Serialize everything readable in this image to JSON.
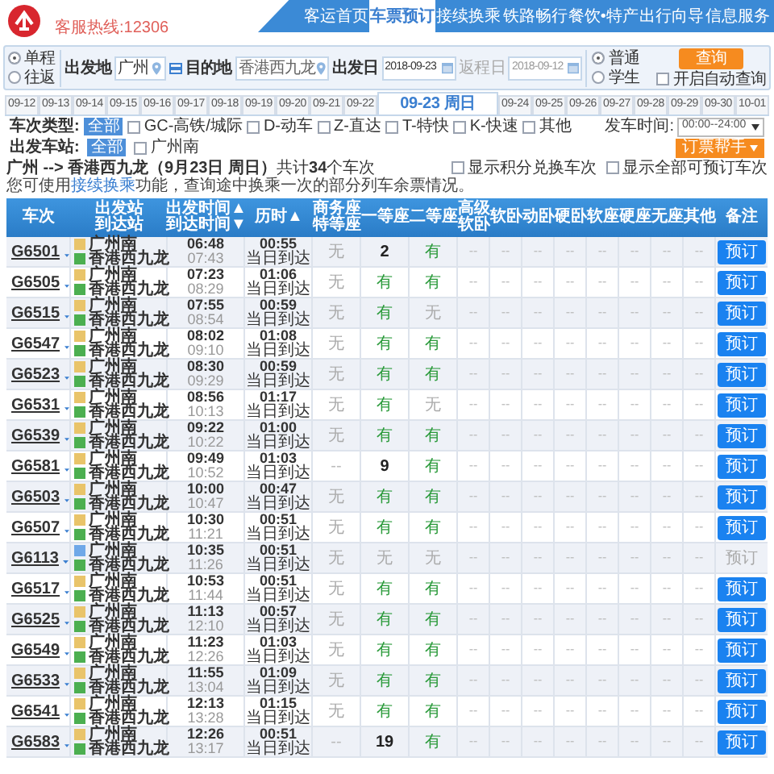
{
  "header": {
    "hotline": "客服热线:12306",
    "nav": [
      {
        "label": "客运首页",
        "selected": false
      },
      {
        "label": "车票预订",
        "selected": true
      },
      {
        "label": "接续换乘",
        "selected": false
      },
      {
        "label": "铁路畅行",
        "selected": false
      },
      {
        "label": "餐饮•特产",
        "selected": false
      },
      {
        "label": "出行向导",
        "selected": false
      },
      {
        "label": "信息服务",
        "selected": false
      }
    ]
  },
  "search": {
    "trip_types": [
      {
        "label": "单程",
        "selected": true
      },
      {
        "label": "往返",
        "selected": false
      }
    ],
    "from": {
      "label": "出发地",
      "value": "广州"
    },
    "to": {
      "label": "目的地",
      "value": "香港西九龙"
    },
    "depart_date": {
      "label": "出发日",
      "value": "2018-09-23"
    },
    "return_date": {
      "label": "返程日",
      "value": "2018-09-12",
      "disabled": true
    },
    "passenger_types": [
      {
        "label": "普通",
        "selected": true
      },
      {
        "label": "学生",
        "selected": false
      }
    ],
    "query_button": "查询",
    "auto_query": {
      "label": "开启自动查询",
      "checked": false
    }
  },
  "dates": [
    {
      "label": "09-12",
      "selected": false
    },
    {
      "label": "09-13",
      "selected": false
    },
    {
      "label": "09-14",
      "selected": false
    },
    {
      "label": "09-15",
      "selected": false
    },
    {
      "label": "09-16",
      "selected": false
    },
    {
      "label": "09-17",
      "selected": false
    },
    {
      "label": "09-18",
      "selected": false
    },
    {
      "label": "09-19",
      "selected": false
    },
    {
      "label": "09-20",
      "selected": false
    },
    {
      "label": "09-21",
      "selected": false
    },
    {
      "label": "09-22",
      "selected": false
    },
    {
      "label": "09-23 周日",
      "selected": true
    },
    {
      "label": "09-24",
      "selected": false
    },
    {
      "label": "09-25",
      "selected": false
    },
    {
      "label": "09-26",
      "selected": false
    },
    {
      "label": "09-27",
      "selected": false
    },
    {
      "label": "09-28",
      "selected": false
    },
    {
      "label": "09-29",
      "selected": false
    },
    {
      "label": "09-30",
      "selected": false
    },
    {
      "label": "10-01",
      "selected": false
    }
  ],
  "filters": {
    "train_type_label": "车次类型:",
    "train_type_all": "全部",
    "train_types": [
      {
        "label": "GC-高铁/城际",
        "checked": false
      },
      {
        "label": "D-动车",
        "checked": false
      },
      {
        "label": "Z-直达",
        "checked": false
      },
      {
        "label": "T-特快",
        "checked": false
      },
      {
        "label": "K-快速",
        "checked": false
      },
      {
        "label": "其他",
        "checked": false
      }
    ],
    "depart_time_label": "发车时间:",
    "depart_time_value": "00:00--24:00",
    "station_label": "出发车站:",
    "station_all": "全部",
    "stations": [
      {
        "label": "广州南",
        "checked": false
      }
    ],
    "helper_button": "订票帮手"
  },
  "summary": {
    "title": "**广州 --> 香港西九龙（9月23日  周日）**共计**34**个车次",
    "hint_before": "您可使用",
    "hint_link": "接续换乘",
    "hint_after": "功能，查询途中换乘一次的部分列车余票情况。",
    "options": [
      {
        "label": "显示积分兑换车次",
        "checked": false
      },
      {
        "label": "显示全部可预订车次",
        "checked": false
      }
    ]
  },
  "table": {
    "columns": [
      [
        "车次"
      ],
      [
        "出发站",
        "到达站"
      ],
      [
        "出发时间▲",
        "到达时间▼"
      ],
      [
        "历时▲"
      ],
      [
        "商务座",
        "特等座"
      ],
      [
        "一等座"
      ],
      [
        "二等座"
      ],
      [
        "高级",
        "软卧"
      ],
      [
        "软卧"
      ],
      [
        "动卧"
      ],
      [
        "硬卧"
      ],
      [
        "软座"
      ],
      [
        "硬座"
      ],
      [
        "无座"
      ],
      [
        "其他"
      ],
      [
        "备注"
      ]
    ],
    "rows": [
      {
        "train": "G6501",
        "from": "广州南",
        "passing_station": false,
        "to": "香港西九龙",
        "depart": "06:48",
        "arrive": "07:43",
        "duration": "00:55",
        "arrival_day": "当日到达",
        "seats": [
          {
            "text": "无",
            "kind": "no"
          },
          {
            "text": "2",
            "kind": "count"
          },
          {
            "text": "有",
            "kind": "yes"
          }
        ],
        "other_seats": [
          "--",
          "--",
          "--",
          "--",
          "--",
          "--",
          "--",
          "--"
        ],
        "book": "预订",
        "bookable": true
      },
      {
        "train": "G6505",
        "from": "广州南",
        "passing_station": false,
        "to": "香港西九龙",
        "depart": "07:23",
        "arrive": "08:29",
        "duration": "01:06",
        "arrival_day": "当日到达",
        "seats": [
          {
            "text": "无",
            "kind": "no"
          },
          {
            "text": "有",
            "kind": "yes"
          },
          {
            "text": "有",
            "kind": "yes"
          }
        ],
        "other_seats": [
          "--",
          "--",
          "--",
          "--",
          "--",
          "--",
          "--",
          "--"
        ],
        "book": "预订",
        "bookable": true
      },
      {
        "train": "G6515",
        "from": "广州南",
        "passing_station": false,
        "to": "香港西九龙",
        "depart": "07:55",
        "arrive": "08:54",
        "duration": "00:59",
        "arrival_day": "当日到达",
        "seats": [
          {
            "text": "无",
            "kind": "no"
          },
          {
            "text": "有",
            "kind": "yes"
          },
          {
            "text": "无",
            "kind": "no"
          }
        ],
        "other_seats": [
          "--",
          "--",
          "--",
          "--",
          "--",
          "--",
          "--",
          "--"
        ],
        "book": "预订",
        "bookable": true
      },
      {
        "train": "G6547",
        "from": "广州南",
        "passing_station": false,
        "to": "香港西九龙",
        "depart": "08:02",
        "arrive": "09:10",
        "duration": "01:08",
        "arrival_day": "当日到达",
        "seats": [
          {
            "text": "无",
            "kind": "no"
          },
          {
            "text": "有",
            "kind": "yes"
          },
          {
            "text": "有",
            "kind": "yes"
          }
        ],
        "other_seats": [
          "--",
          "--",
          "--",
          "--",
          "--",
          "--",
          "--",
          "--"
        ],
        "book": "预订",
        "bookable": true
      },
      {
        "train": "G6523",
        "from": "广州南",
        "passing_station": false,
        "to": "香港西九龙",
        "depart": "08:30",
        "arrive": "09:29",
        "duration": "00:59",
        "arrival_day": "当日到达",
        "seats": [
          {
            "text": "无",
            "kind": "no"
          },
          {
            "text": "有",
            "kind": "yes"
          },
          {
            "text": "有",
            "kind": "yes"
          }
        ],
        "other_seats": [
          "--",
          "--",
          "--",
          "--",
          "--",
          "--",
          "--",
          "--"
        ],
        "book": "预订",
        "bookable": true
      },
      {
        "train": "G6531",
        "from": "广州南",
        "passing_station": false,
        "to": "香港西九龙",
        "depart": "08:56",
        "arrive": "10:13",
        "duration": "01:17",
        "arrival_day": "当日到达",
        "seats": [
          {
            "text": "无",
            "kind": "no"
          },
          {
            "text": "有",
            "kind": "yes"
          },
          {
            "text": "无",
            "kind": "no"
          }
        ],
        "other_seats": [
          "--",
          "--",
          "--",
          "--",
          "--",
          "--",
          "--",
          "--"
        ],
        "book": "预订",
        "bookable": true
      },
      {
        "train": "G6539",
        "from": "广州南",
        "passing_station": false,
        "to": "香港西九龙",
        "depart": "09:22",
        "arrive": "10:22",
        "duration": "01:00",
        "arrival_day": "当日到达",
        "seats": [
          {
            "text": "无",
            "kind": "no"
          },
          {
            "text": "有",
            "kind": "yes"
          },
          {
            "text": "有",
            "kind": "yes"
          }
        ],
        "other_seats": [
          "--",
          "--",
          "--",
          "--",
          "--",
          "--",
          "--",
          "--"
        ],
        "book": "预订",
        "bookable": true
      },
      {
        "train": "G6581",
        "from": "广州南",
        "passing_station": false,
        "to": "香港西九龙",
        "depart": "09:49",
        "arrive": "10:52",
        "duration": "01:03",
        "arrival_day": "当日到达",
        "seats": [
          {
            "text": "--",
            "kind": "none"
          },
          {
            "text": "9",
            "kind": "count"
          },
          {
            "text": "有",
            "kind": "yes"
          }
        ],
        "other_seats": [
          "--",
          "--",
          "--",
          "--",
          "--",
          "--",
          "--",
          "--"
        ],
        "book": "预订",
        "bookable": true
      },
      {
        "train": "G6503",
        "from": "广州南",
        "passing_station": false,
        "to": "香港西九龙",
        "depart": "10:00",
        "arrive": "10:47",
        "duration": "00:47",
        "arrival_day": "当日到达",
        "seats": [
          {
            "text": "无",
            "kind": "no"
          },
          {
            "text": "有",
            "kind": "yes"
          },
          {
            "text": "有",
            "kind": "yes"
          }
        ],
        "other_seats": [
          "--",
          "--",
          "--",
          "--",
          "--",
          "--",
          "--",
          "--"
        ],
        "book": "预订",
        "bookable": true
      },
      {
        "train": "G6507",
        "from": "广州南",
        "passing_station": false,
        "to": "香港西九龙",
        "depart": "10:30",
        "arrive": "11:21",
        "duration": "00:51",
        "arrival_day": "当日到达",
        "seats": [
          {
            "text": "无",
            "kind": "no"
          },
          {
            "text": "有",
            "kind": "yes"
          },
          {
            "text": "有",
            "kind": "yes"
          }
        ],
        "other_seats": [
          "--",
          "--",
          "--",
          "--",
          "--",
          "--",
          "--",
          "--"
        ],
        "book": "预订",
        "bookable": true
      },
      {
        "train": "G6113",
        "from": "广州南",
        "passing_station": true,
        "to": "香港西九龙",
        "depart": "10:35",
        "arrive": "11:26",
        "duration": "00:51",
        "arrival_day": "当日到达",
        "seats": [
          {
            "text": "无",
            "kind": "no"
          },
          {
            "text": "无",
            "kind": "no"
          },
          {
            "text": "无",
            "kind": "no"
          }
        ],
        "other_seats": [
          "--",
          "--",
          "--",
          "--",
          "--",
          "--",
          "--",
          "--"
        ],
        "book": "预订",
        "bookable": false
      },
      {
        "train": "G6517",
        "from": "广州南",
        "passing_station": false,
        "to": "香港西九龙",
        "depart": "10:53",
        "arrive": "11:44",
        "duration": "00:51",
        "arrival_day": "当日到达",
        "seats": [
          {
            "text": "无",
            "kind": "no"
          },
          {
            "text": "有",
            "kind": "yes"
          },
          {
            "text": "有",
            "kind": "yes"
          }
        ],
        "other_seats": [
          "--",
          "--",
          "--",
          "--",
          "--",
          "--",
          "--",
          "--"
        ],
        "book": "预订",
        "bookable": true
      },
      {
        "train": "G6525",
        "from": "广州南",
        "passing_station": false,
        "to": "香港西九龙",
        "depart": "11:13",
        "arrive": "12:10",
        "duration": "00:57",
        "arrival_day": "当日到达",
        "seats": [
          {
            "text": "无",
            "kind": "no"
          },
          {
            "text": "有",
            "kind": "yes"
          },
          {
            "text": "有",
            "kind": "yes"
          }
        ],
        "other_seats": [
          "--",
          "--",
          "--",
          "--",
          "--",
          "--",
          "--",
          "--"
        ],
        "book": "预订",
        "bookable": true
      },
      {
        "train": "G6549",
        "from": "广州南",
        "passing_station": false,
        "to": "香港西九龙",
        "depart": "11:23",
        "arrive": "12:26",
        "duration": "01:03",
        "arrival_day": "当日到达",
        "seats": [
          {
            "text": "无",
            "kind": "no"
          },
          {
            "text": "有",
            "kind": "yes"
          },
          {
            "text": "有",
            "kind": "yes"
          }
        ],
        "other_seats": [
          "--",
          "--",
          "--",
          "--",
          "--",
          "--",
          "--",
          "--"
        ],
        "book": "预订",
        "bookable": true
      },
      {
        "train": "G6533",
        "from": "广州南",
        "passing_station": false,
        "to": "香港西九龙",
        "depart": "11:55",
        "arrive": "13:04",
        "duration": "01:09",
        "arrival_day": "当日到达",
        "seats": [
          {
            "text": "无",
            "kind": "no"
          },
          {
            "text": "有",
            "kind": "yes"
          },
          {
            "text": "有",
            "kind": "yes"
          }
        ],
        "other_seats": [
          "--",
          "--",
          "--",
          "--",
          "--",
          "--",
          "--",
          "--"
        ],
        "book": "预订",
        "bookable": true
      },
      {
        "train": "G6541",
        "from": "广州南",
        "passing_station": false,
        "to": "香港西九龙",
        "depart": "12:13",
        "arrive": "13:28",
        "duration": "01:15",
        "arrival_day": "当日到达",
        "seats": [
          {
            "text": "无",
            "kind": "no"
          },
          {
            "text": "有",
            "kind": "yes"
          },
          {
            "text": "有",
            "kind": "yes"
          }
        ],
        "other_seats": [
          "--",
          "--",
          "--",
          "--",
          "--",
          "--",
          "--",
          "--"
        ],
        "book": "预订",
        "bookable": true
      },
      {
        "train": "G6583",
        "from": "广州南",
        "passing_station": false,
        "to": "香港西九龙",
        "depart": "12:26",
        "arrive": "13:17",
        "duration": "00:51",
        "arrival_day": "当日到达",
        "seats": [
          {
            "text": "--",
            "kind": "none"
          },
          {
            "text": "19",
            "kind": "count"
          },
          {
            "text": "有",
            "kind": "yes"
          }
        ],
        "other_seats": [
          "--",
          "--",
          "--",
          "--",
          "--",
          "--",
          "--",
          "--"
        ],
        "book": "预订",
        "bookable": true
      }
    ]
  }
}
